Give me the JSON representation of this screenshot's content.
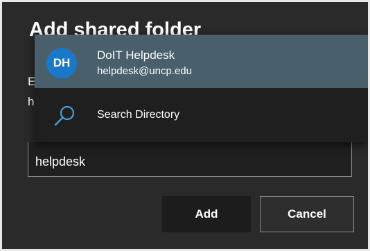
{
  "dialog": {
    "title": "Add shared folder",
    "instruction_fragments": [
      "E",
      "h"
    ]
  },
  "suggestions": {
    "contact": {
      "initials": "DH",
      "name": "DoIT Helpdesk",
      "email": "helpdesk@uncp.edu"
    },
    "search": {
      "label": "Search Directory",
      "icon": "search-icon"
    }
  },
  "input": {
    "value": "helpdesk"
  },
  "buttons": {
    "add": "Add",
    "cancel": "Cancel"
  },
  "colors": {
    "dialog_bg": "#2a2a2a",
    "dropdown_bg": "#1f1f1f",
    "highlight_bg": "#4a5f6c",
    "avatar_bg": "#1a78c8",
    "search_icon": "#4a9fd8"
  }
}
